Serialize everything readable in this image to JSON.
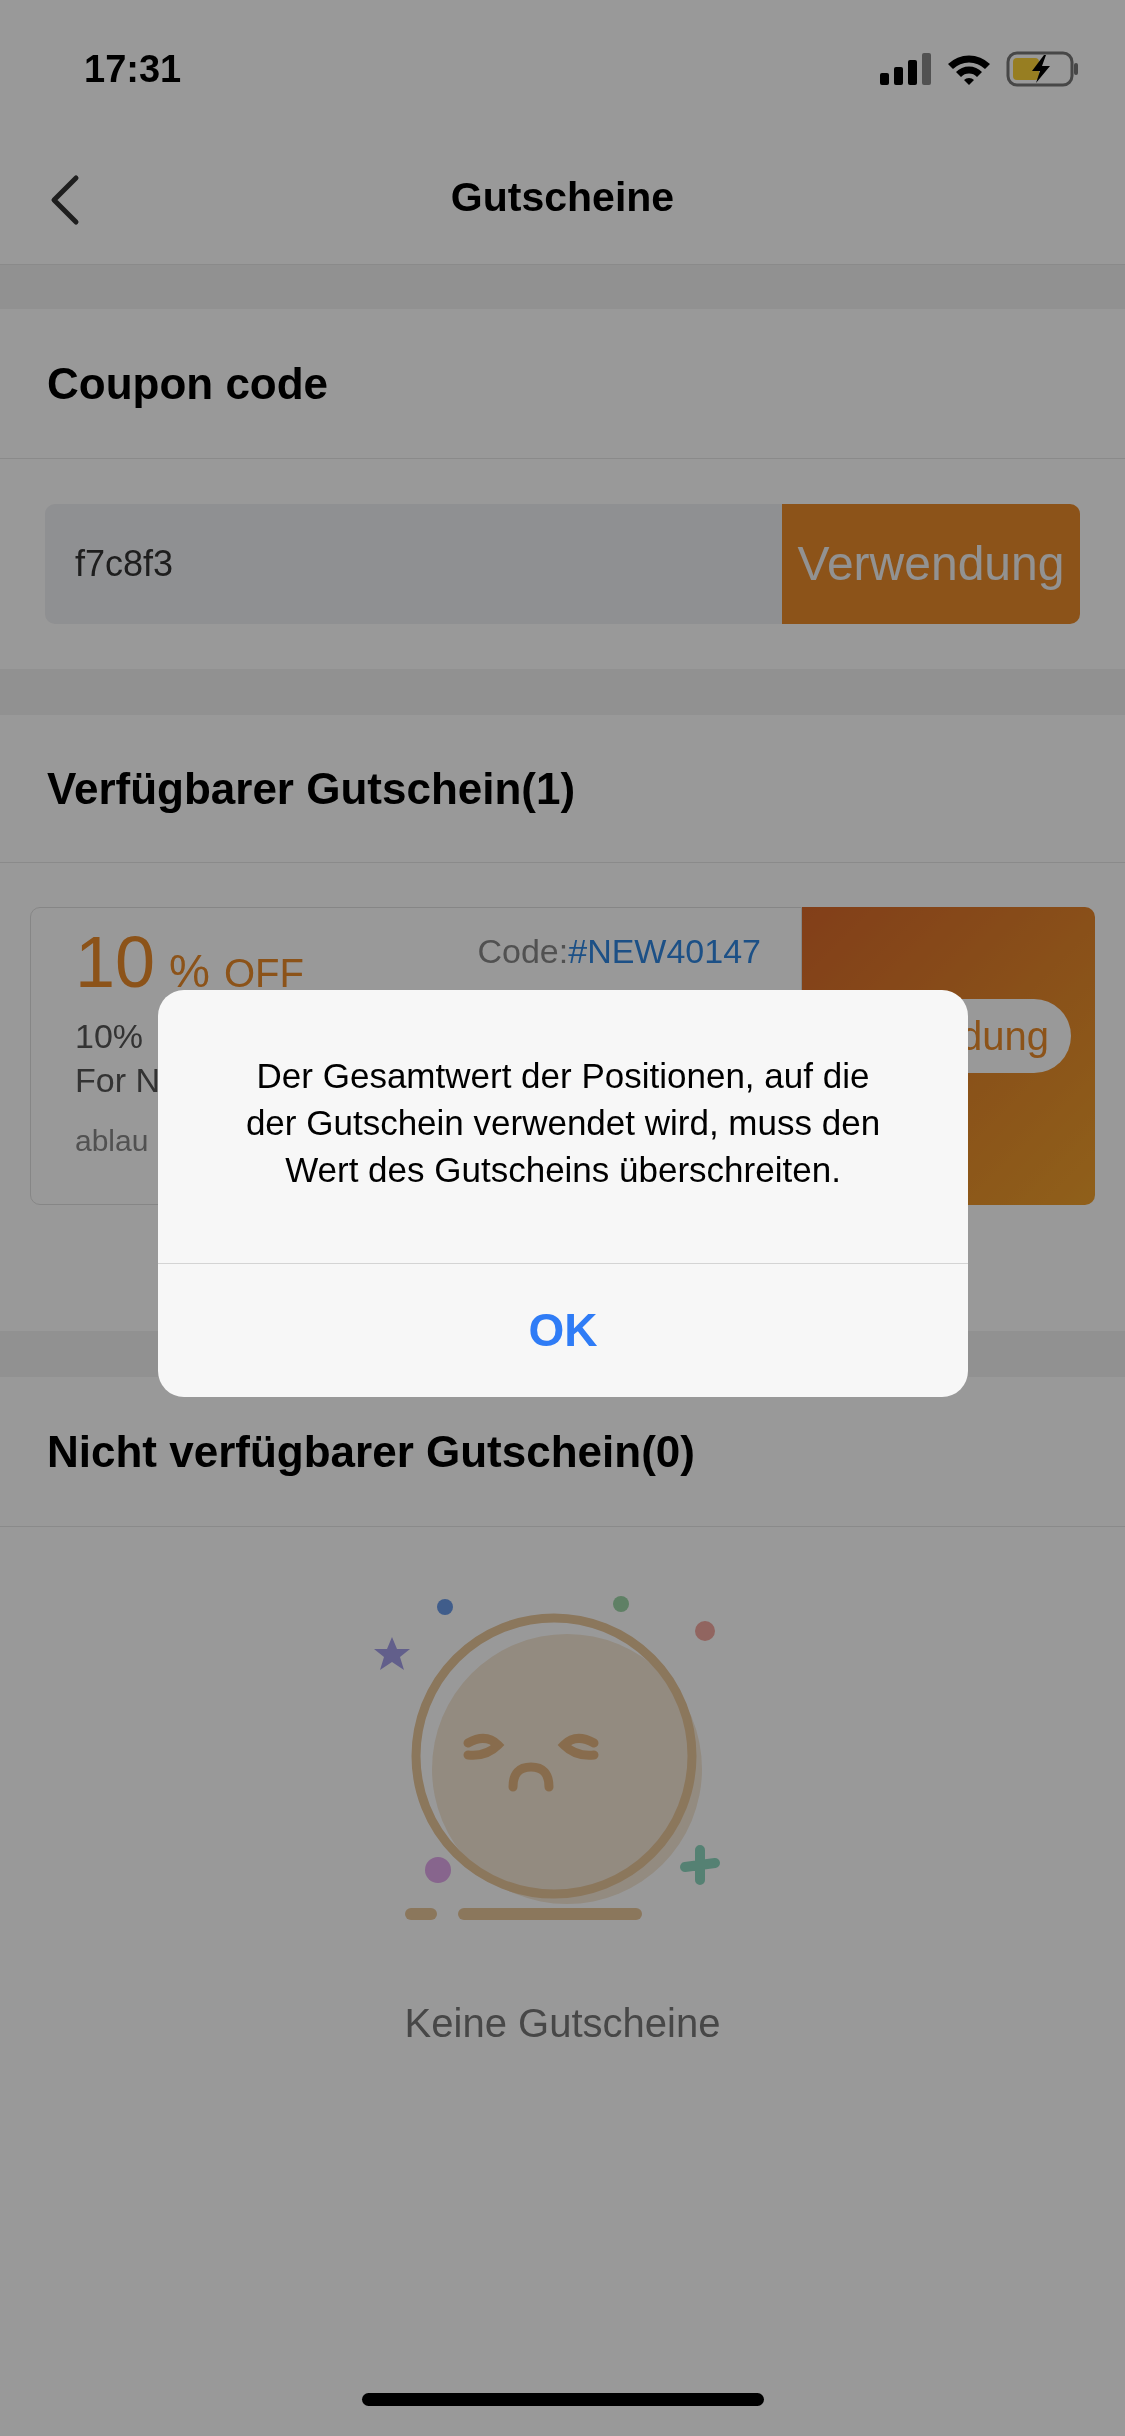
{
  "status_bar": {
    "time": "17:31"
  },
  "nav": {
    "title": "Gutscheine"
  },
  "coupon_code": {
    "heading": "Coupon code",
    "value": "f7c8f3",
    "button": "Verwendung"
  },
  "available": {
    "heading": "Verfügbarer Gutschein(1)",
    "coupons": [
      {
        "amount": "10",
        "unit": "%",
        "suffix": "OFF",
        "code_label": "Code:",
        "code": "#NEW40147",
        "line_1": "10%",
        "line_2": "For N",
        "expiry": "ablau",
        "button": "dung"
      }
    ]
  },
  "unavailable": {
    "heading": "Nicht verfügbarer Gutschein(0)",
    "empty_text": "Keine Gutscheine"
  },
  "alert": {
    "message": "Der Gesamtwert der Positionen, auf die der Gutschein verwendet wird, muss den Wert des Gutscheins überschreiten.",
    "button": "OK"
  }
}
